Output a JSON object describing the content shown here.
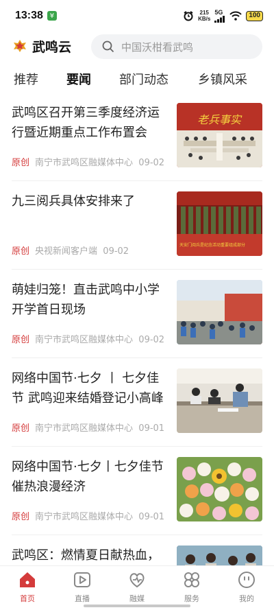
{
  "status_bar": {
    "time": "13:38",
    "app_badge": "¥",
    "net_speed_value": "215",
    "net_speed_unit": "KB/s",
    "signal": "5G",
    "battery": "100"
  },
  "header": {
    "app_name": "武鸣云",
    "search_placeholder": "中国沃柑看武鸣"
  },
  "tabs": [
    {
      "label": "推荐",
      "active": false
    },
    {
      "label": "要闻",
      "active": true
    },
    {
      "label": "部门动态",
      "active": false
    },
    {
      "label": "乡镇风采",
      "active": false
    }
  ],
  "news": [
    {
      "title": "武鸣区召开第三季度经济运行暨近期重点工作布置会",
      "tag": "原创",
      "source": "南宁市武鸣区融媒体中心",
      "date": "09-02",
      "thumb_text": "老兵事实"
    },
    {
      "title": "九三阅兵具体安排来了",
      "tag": "原创",
      "source": "央视新闻客户端",
      "date": "09-02",
      "thumb_text": "天安门阅兵是纪念活动重要组成部分"
    },
    {
      "title": "萌娃归笼！直击武鸣中小学开学首日现场",
      "tag": "原创",
      "source": "南宁市武鸣区融媒体中心",
      "date": "09-02",
      "thumb_text": ""
    },
    {
      "title": "网络中国节·七夕 丨 七夕佳节 武鸣迎来结婚登记小高峰",
      "tag": "原创",
      "source": "南宁市武鸣区融媒体中心",
      "date": "09-01",
      "thumb_text": ""
    },
    {
      "title": "网络中国节·七夕丨七夕佳节 催热浪漫经济",
      "tag": "原创",
      "source": "南宁市武鸣区融媒体中心",
      "date": "09-01",
      "thumb_text": ""
    },
    {
      "title": "武鸣区：燃情夏日献热血，",
      "tag": "",
      "source": "",
      "date": "",
      "thumb_text": ""
    }
  ],
  "bottom_nav": [
    {
      "label": "首页",
      "icon": "home-icon",
      "active": true
    },
    {
      "label": "直播",
      "icon": "live-play-icon",
      "active": false
    },
    {
      "label": "融媒",
      "icon": "heart-media-icon",
      "active": false
    },
    {
      "label": "服务",
      "icon": "services-grid-icon",
      "active": false
    },
    {
      "label": "我的",
      "icon": "profile-face-icon",
      "active": false
    }
  ],
  "colors": {
    "accent": "#d43b3b",
    "meta_text": "#aaaaaa",
    "search_bg": "#f2f3f5"
  }
}
